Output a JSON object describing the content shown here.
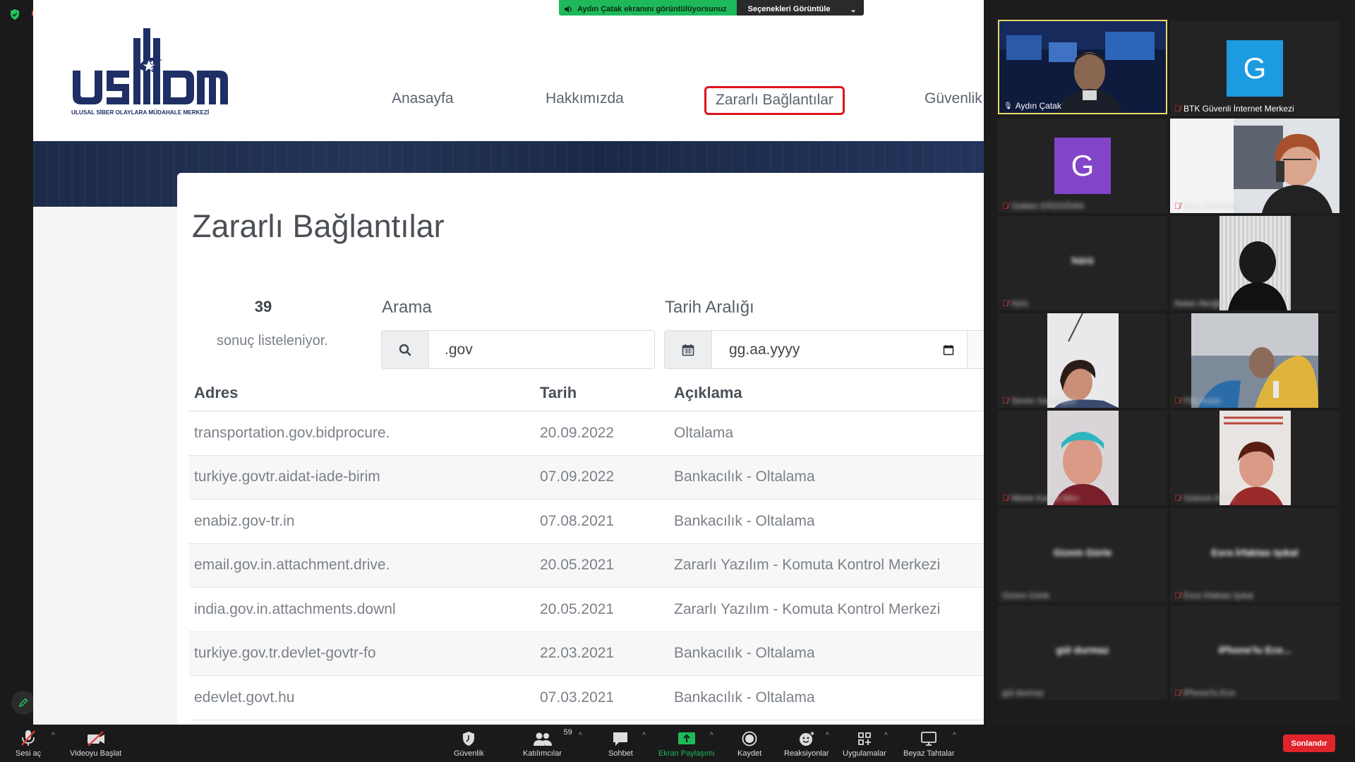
{
  "share_banner": {
    "viewing_text": "Aydın Çatak ekranını görüntülüyorsunuz",
    "options_label": "Seçenekleri Görüntüle"
  },
  "site": {
    "nav": {
      "home": "Anasayfa",
      "about": "Hakkımızda",
      "malicious_links": "Zararlı Bağlantılar",
      "security": "Güvenlik"
    },
    "page_title": "Zararlı Bağlantılar",
    "result_count": "39",
    "result_text": "sonuç listeleniyor.",
    "search": {
      "label": "Arama",
      "value": ".gov"
    },
    "date_range": {
      "label": "Tarih Aralığı",
      "placeholder": "gg.aa.yyyy"
    },
    "table": {
      "headers": {
        "address": "Adres",
        "date": "Tarih",
        "description": "Açıklama"
      },
      "rows": [
        {
          "address": "transportation.gov.bidprocure.",
          "date": "20.09.2022",
          "description": "Oltalama"
        },
        {
          "address": "turkiye.govtr.aidat-iade-birim",
          "date": "07.09.2022",
          "description": "Bankacılık - Oltalama"
        },
        {
          "address": "enabiz.gov-tr.in",
          "date": "07.08.2021",
          "description": "Bankacılık - Oltalama"
        },
        {
          "address": "email.gov.in.attachment.drive.",
          "date": "20.05.2021",
          "description": "Zararlı Yazılım - Komuta Kontrol Merkezi"
        },
        {
          "address": "india.gov.in.attachments.downl",
          "date": "20.05.2021",
          "description": "Zararlı Yazılım - Komuta Kontrol Merkezi"
        },
        {
          "address": "turkiye.gov.tr.devlet-govtr-fo",
          "date": "22.03.2021",
          "description": "Bankacılık - Oltalama"
        },
        {
          "address": "edevlet.govt.hu",
          "date": "07.03.2021",
          "description": "Bankacılık - Oltalama"
        }
      ]
    }
  },
  "participants": {
    "tiles": [
      {
        "name": "Aydın Çatak"
      },
      {
        "name": "BTK Güvenli İnternet Merkezi",
        "initial": "G"
      },
      {
        "name": "Gülden ERDOĞAN",
        "initial": "G"
      },
      {
        "name": "Arzu Sarıkaya"
      },
      {
        "name": "hürü",
        "center": "hürü"
      },
      {
        "name": "Nalan Akoğlu"
      },
      {
        "name": "Sevim Sarıdoğan"
      },
      {
        "name": "Filiz Aslan"
      },
      {
        "name": "Melek Kandil Altın"
      },
      {
        "name": "Gülsüm Erçin"
      },
      {
        "name": "Gizem Gürle",
        "center": "Gizem Gürle"
      },
      {
        "name": "Esra İrfaktas Işıkal",
        "center": "Esra İrfaktas Işıkal"
      },
      {
        "name": "gül durmaz",
        "center": "gül durmaz"
      },
      {
        "name": "iPhone'lu Ece",
        "center": "iPhone'lu Ece..."
      }
    ]
  },
  "toolbar": {
    "unmute": "Sesi aç",
    "start_video": "Videoyu Başlat",
    "security": "Güvenlik",
    "participants": "Katılımcılar",
    "participant_count": "59",
    "chat": "Sohbet",
    "share_screen": "Ekran Paylaşımı",
    "record": "Kaydet",
    "reactions": "Reaksiyonlar",
    "apps": "Uygulamalar",
    "whiteboards": "Beyaz Tahtalar",
    "end": "Sonlandır"
  },
  "colors": {
    "share_green": "#1eb95b",
    "highlight_red": "#e0141e",
    "logo_navy": "#1f2f66",
    "end_red": "#e0242b"
  },
  "icons": [
    "shield-icon",
    "search-icon",
    "calendar-icon",
    "mic-muted-icon",
    "video-off-icon",
    "participants-icon",
    "chat-icon",
    "share-screen-icon",
    "record-icon",
    "reactions-icon",
    "apps-icon",
    "whiteboard-icon",
    "pencil-icon"
  ]
}
